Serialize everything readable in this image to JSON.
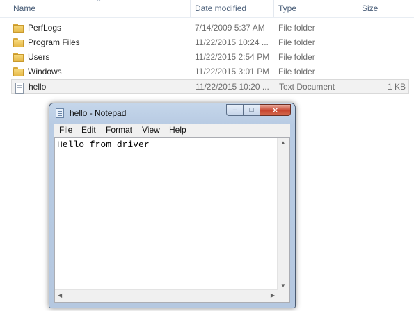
{
  "explorer": {
    "columns": [
      "Name",
      "Date modified",
      "Type",
      "Size"
    ],
    "rows": [
      {
        "name": "PerfLogs",
        "date": "7/14/2009 5:37 AM",
        "type": "File folder",
        "size": "",
        "icon": "folder-icon"
      },
      {
        "name": "Program Files",
        "date": "11/22/2015 10:24 ...",
        "type": "File folder",
        "size": "",
        "icon": "folder-icon"
      },
      {
        "name": "Users",
        "date": "11/22/2015 2:54 PM",
        "type": "File folder",
        "size": "",
        "icon": "folder-icon"
      },
      {
        "name": "Windows",
        "date": "11/22/2015 3:01 PM",
        "type": "File folder",
        "size": "",
        "icon": "folder-icon"
      },
      {
        "name": "hello",
        "date": "11/22/2015 10:20 ...",
        "type": "Text Document",
        "size": "1 KB",
        "icon": "text-file-icon",
        "selected": true
      }
    ]
  },
  "notepad": {
    "title": "hello - Notepad",
    "menu": [
      "File",
      "Edit",
      "Format",
      "View",
      "Help"
    ],
    "content": "Hello from driver",
    "controls": {
      "minimize": "–",
      "maximize": "□",
      "close": "✕"
    }
  }
}
